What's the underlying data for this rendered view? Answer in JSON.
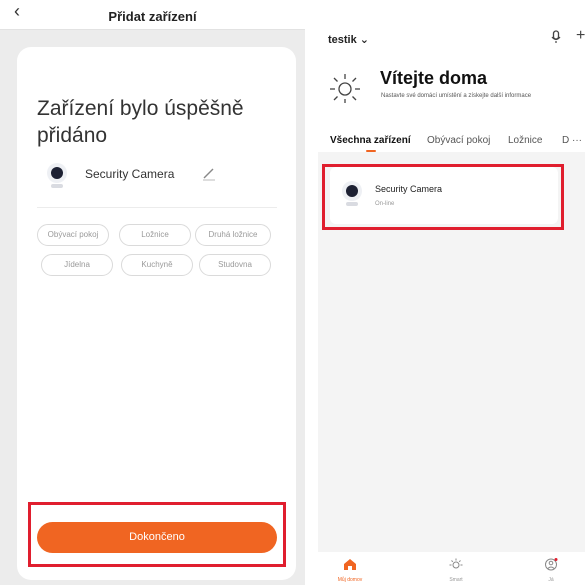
{
  "left_screen": {
    "header": {
      "back_glyph": "‹",
      "title": "Přidat zařízení"
    },
    "success_message": "Zařízení bylo úspěšně přidáno",
    "device": {
      "name": "Security Camera",
      "icon": "camera-icon",
      "edit_icon": "pencil-icon"
    },
    "rooms": [
      "Obývací pokoj",
      "Ložnice",
      "Druhá ložnice",
      "Jídelna",
      "Kuchyně",
      "Studovna"
    ],
    "done_button": "Dokončeno"
  },
  "right_screen": {
    "user": "testik ⌄",
    "welcome_title": "Vítejte doma",
    "welcome_subtitle": "Nastavte své domácí umístění a získejte další informace",
    "tabs": [
      "Všechna zařízení",
      "Obývací pokoj",
      "Ložnice",
      "D",
      "···"
    ],
    "device": {
      "name": "Security Camera",
      "status": "On-line"
    },
    "tabbar": [
      {
        "label": "Můj domov",
        "icon": "home-icon"
      },
      {
        "label": "Smart",
        "icon": "sun-icon"
      },
      {
        "label": "Já",
        "icon": "profile-icon"
      }
    ]
  },
  "colors": {
    "accent": "#f06522",
    "highlight": "#e01e2e"
  }
}
